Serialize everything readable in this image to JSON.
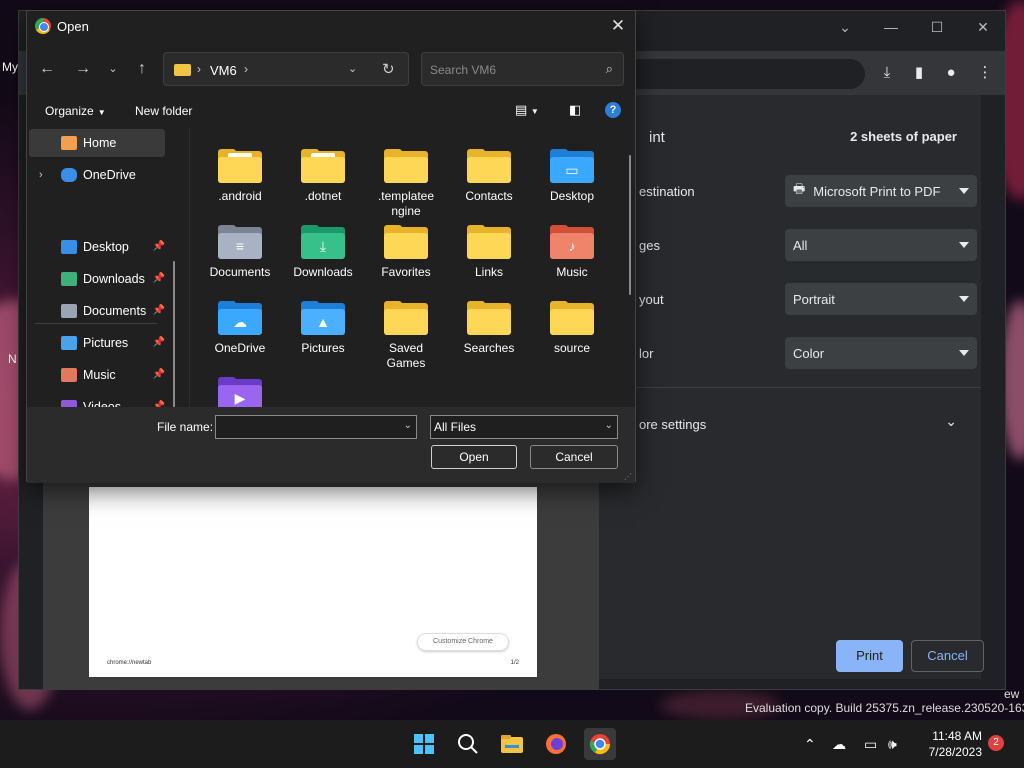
{
  "desktop": {
    "frag_my": "My",
    "frag_n": "N"
  },
  "chrome": {
    "print": {
      "title_partial": "int",
      "sheets": "2 sheets of paper",
      "destination_label": "estination",
      "destination_value": "Microsoft Print to PDF",
      "pages_label": "ges",
      "pages_value": "All",
      "layout_label": "yout",
      "layout_value": "Portrait",
      "color_label": "lor",
      "color_value": "Color",
      "more_settings": "ore settings",
      "print_button": "Print",
      "cancel_button": "Cancel"
    },
    "preview": {
      "customize_button": "Customize Chrome",
      "url": "chrome://newtab",
      "page_num": "1/2"
    }
  },
  "watermark": {
    "text": "Evaluation copy. Build 25375.zn_release.230520-1632",
    "frag": "ew"
  },
  "open_dialog": {
    "title": "Open",
    "breadcrumb": "VM6",
    "search_placeholder": "Search VM6",
    "organize": "Organize",
    "new_folder": "New folder",
    "nav": {
      "home": "Home",
      "onedrive": "OneDrive",
      "quick": [
        {
          "label": "Desktop",
          "icon": "desktop-icon",
          "color": "#3a8ee6"
        },
        {
          "label": "Downloads",
          "icon": "downloads-icon",
          "color": "#3fb07a"
        },
        {
          "label": "Documents",
          "icon": "documents-icon",
          "color": "#9aa4b4"
        },
        {
          "label": "Pictures",
          "icon": "pictures-icon",
          "color": "#4aa3e8"
        },
        {
          "label": "Music",
          "icon": "music-icon",
          "color": "#e07a5f"
        },
        {
          "label": "Videos",
          "icon": "videos-icon",
          "color": "#8e5ad8"
        }
      ]
    },
    "items": [
      {
        "label": ".android",
        "kind": "folder-paper"
      },
      {
        "label": ".dotnet",
        "kind": "folder-paper"
      },
      {
        "label": ".templateengine",
        "line1": ".templatee",
        "line2": "ngine",
        "kind": "folder"
      },
      {
        "label": "Contacts",
        "kind": "folder"
      },
      {
        "label": "Desktop",
        "kind": "desktop"
      },
      {
        "label": "Documents",
        "kind": "documents"
      },
      {
        "label": "Downloads",
        "kind": "downloads"
      },
      {
        "label": "Favorites",
        "kind": "folder"
      },
      {
        "label": "Links",
        "kind": "folder"
      },
      {
        "label": "Music",
        "kind": "music"
      },
      {
        "label": "OneDrive",
        "kind": "onedrive"
      },
      {
        "label": "Pictures",
        "kind": "pictures"
      },
      {
        "label": "Saved Games",
        "line1": "Saved",
        "line2": "Games",
        "kind": "folder"
      },
      {
        "label": "Searches",
        "kind": "folder"
      },
      {
        "label": "source",
        "kind": "folder"
      },
      {
        "label": "Videos",
        "kind": "videos"
      }
    ],
    "file_name_label": "File name:",
    "file_name_value": "",
    "file_type": "All Files",
    "open_button": "Open",
    "cancel_button": "Cancel"
  },
  "taskbar": {
    "time": "11:48 AM",
    "date": "7/28/2023",
    "notification_count": "2"
  }
}
